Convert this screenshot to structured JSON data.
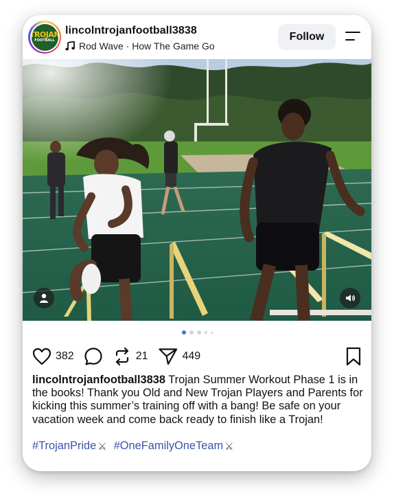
{
  "post": {
    "account": "lincolntrojanfootball3838",
    "avatar_text_top": "TROJAN",
    "avatar_text_bottom": "FOOTBALL",
    "music": "Rod Wave · How The Game Go",
    "follow_label": "Follow",
    "likes": "382",
    "reposts": "21",
    "shares": "449",
    "carousel": {
      "total": 5,
      "active_index": 0
    },
    "caption_user": "lincolntrojanfootball3838",
    "caption_text": " Trojan Summer Workout Phase 1 is in the books! Thank you Old and New Trojan Players and Parents for kicking this summer’s training off with a bang! Be safe on your vacation week and come back ready to finish like a Trojan!",
    "hashtags": [
      {
        "tag": "#TrojanPride",
        "emoji": "⚔"
      },
      {
        "tag": "#OneFamilyOneTeam",
        "emoji": "⚔"
      }
    ]
  },
  "icons": {
    "avatar": "team-logo",
    "music": "music-note-icon",
    "menu": "menu-icon",
    "like": "heart-icon",
    "comment": "comment-bubble-icon",
    "repost": "repost-icon",
    "share": "send-icon",
    "bookmark": "bookmark-icon",
    "user_tag": "user-icon",
    "sound": "speaker-icon"
  },
  "colors": {
    "follow_bg": "#eff1f4",
    "hashtag": "#3a54a8",
    "carousel_active": "#4a6fd6"
  }
}
